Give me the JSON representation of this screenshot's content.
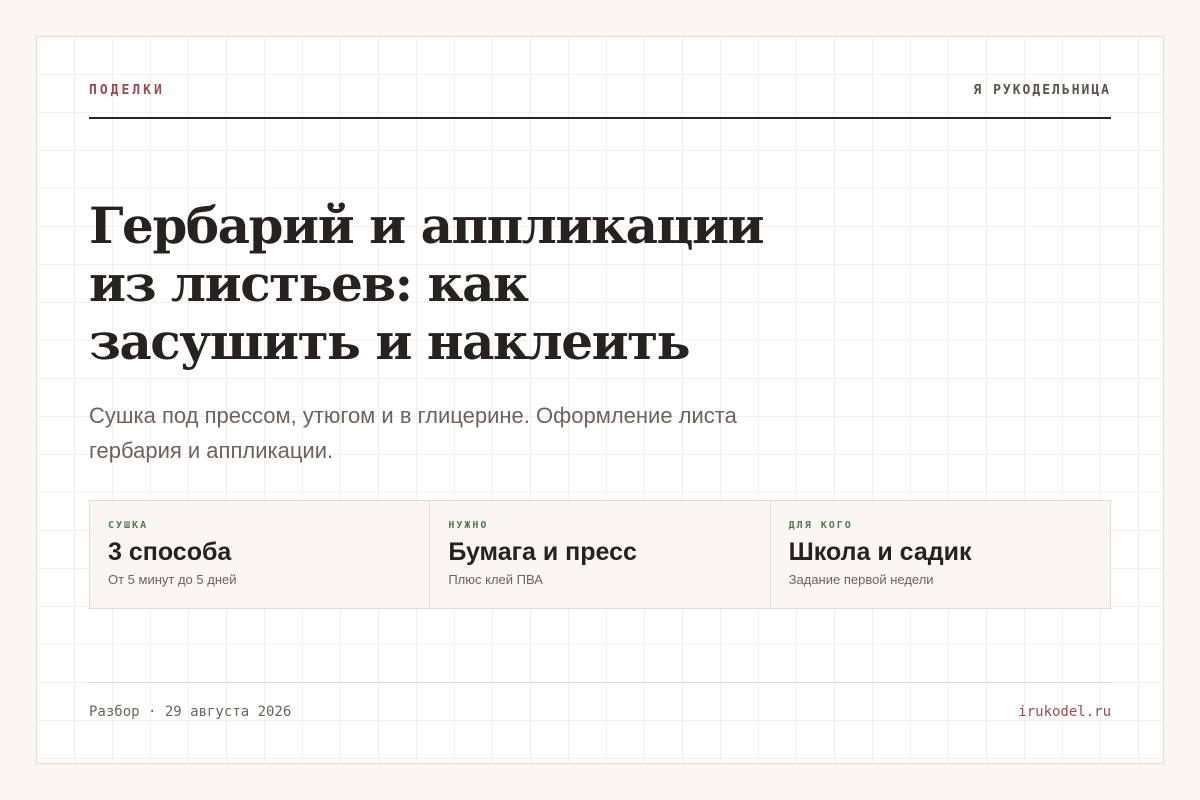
{
  "header": {
    "kicker": "ПОДЕЛКИ",
    "brand": "Я РУКОДЕЛЬНИЦА"
  },
  "article": {
    "title": "Гербарий и аппликации из листьев: как засушить и наклеить",
    "subtitle": "Сушка под прессом, утюгом и в глицерине. Оформление листа гербария и аппликации."
  },
  "facts": [
    {
      "label": "СУШКА",
      "value": "3 способа",
      "note": "От 5 минут до 5 дней"
    },
    {
      "label": "НУЖНО",
      "value": "Бумага и пресс",
      "note": "Плюс клей ПВА"
    },
    {
      "label": "ДЛЯ КОГО",
      "value": "Школа и садик",
      "note": "Задание первой недели"
    }
  ],
  "footer": {
    "meta": "Разбор · 29 августа 2026",
    "site": "irukodel.ru"
  },
  "colors": {
    "accent": "#9a4a55",
    "label_green": "#4f7a55",
    "text_dark": "#272220",
    "text_muted": "#6d625c",
    "background": "#faf6f3"
  }
}
